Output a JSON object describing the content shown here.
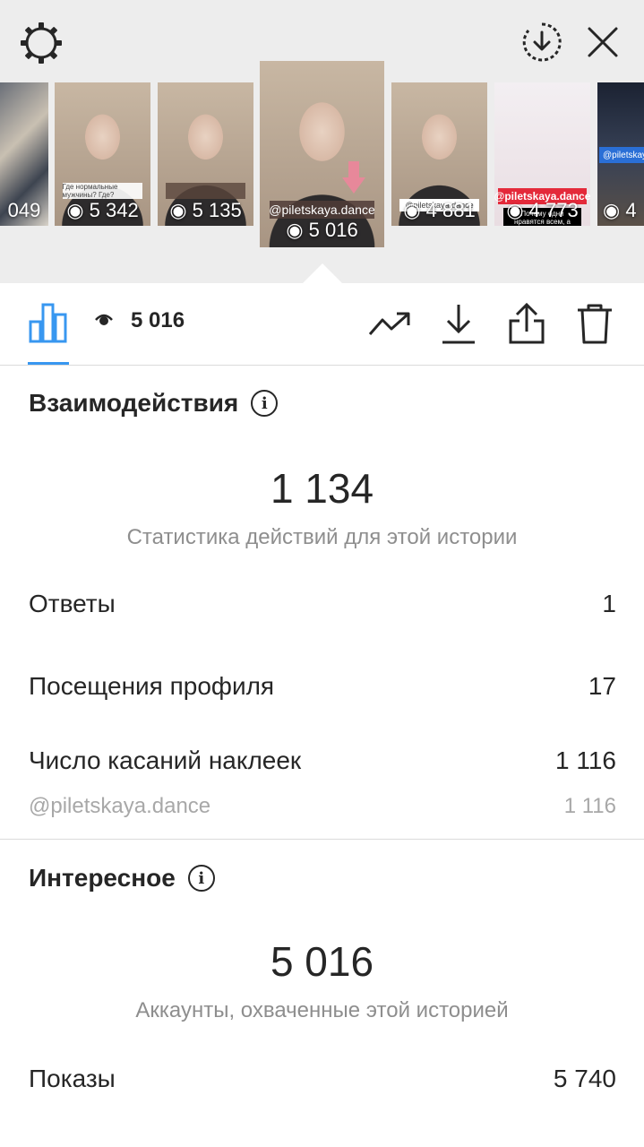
{
  "thumbnails": [
    {
      "views": "049",
      "style": "collage"
    },
    {
      "views": "5 342",
      "sticker": "Где нормальные мужчины? Где?"
    },
    {
      "views": "5 135",
      "sticker": ""
    },
    {
      "views": "5 016",
      "sticker": "@piletskaya.dance",
      "selected": true
    },
    {
      "views": "4 881",
      "sticker": "@piletskaya.dance"
    },
    {
      "views": "4 773",
      "sticker": "@piletskaya.dance",
      "style": "pink",
      "caption": "Почему одни нравятся всем, а другие никому?"
    },
    {
      "views": "4",
      "sticker": "@piletskaya.dance",
      "style": "night"
    }
  ],
  "toolbar": {
    "views_value": "5 016"
  },
  "interactions": {
    "title": "Взаимодействия",
    "total": "1 134",
    "subtitle": "Статистика действий для этой истории",
    "rows": [
      {
        "label": "Ответы",
        "value": "1"
      },
      {
        "label": "Посещения профиля",
        "value": "17"
      },
      {
        "label": "Число касаний наклеек",
        "value": "1 116"
      }
    ],
    "sticker_row": {
      "label": "@piletskaya.dance",
      "value": "1 116"
    }
  },
  "discovery": {
    "title": "Интересное",
    "total": "5 016",
    "subtitle": "Аккаунты, охваченные этой историей",
    "rows": [
      {
        "label": "Показы",
        "value": "5 740"
      }
    ]
  },
  "colors": {
    "accent": "#3897f0",
    "text": "#262626",
    "muted": "#8e8e8e",
    "sticker_red": "#e4293a"
  }
}
